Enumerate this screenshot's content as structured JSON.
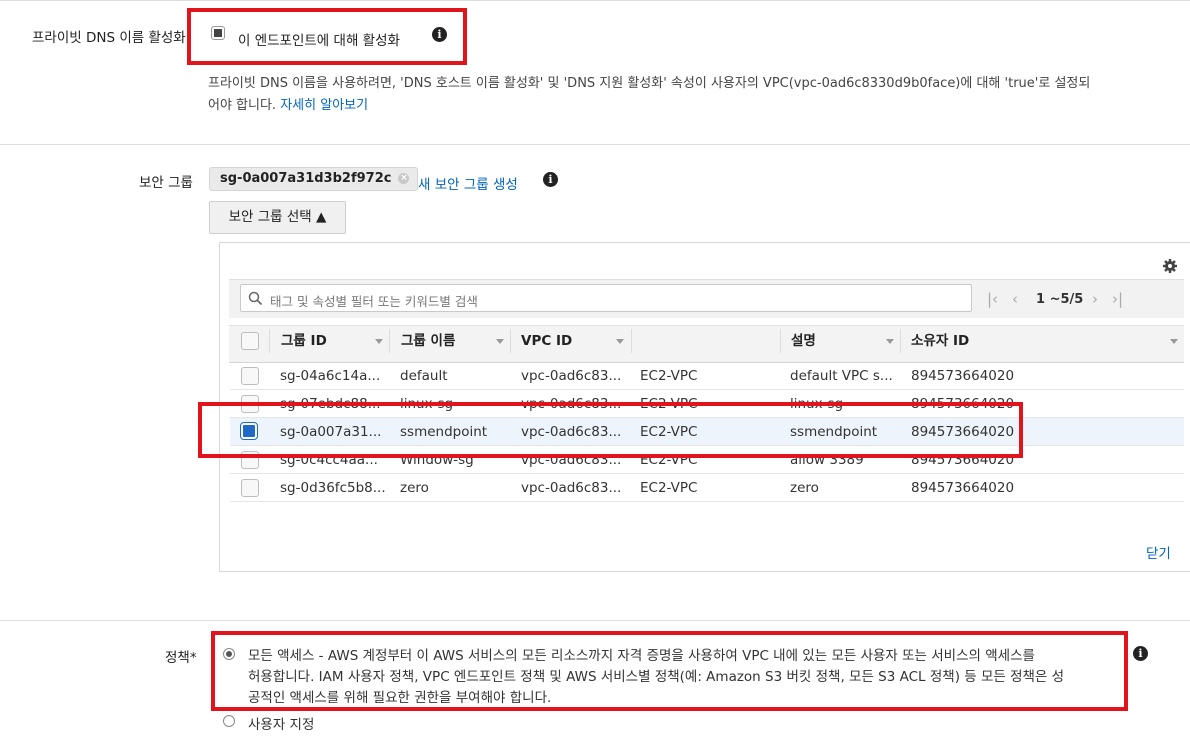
{
  "private_dns": {
    "label": "프라이빗 DNS 이름 활성화",
    "checkbox_label": "이 엔드포인트에 대해 활성화",
    "checked": true,
    "help_text": "프라이빗 DNS 이름을 사용하려면, 'DNS 호스트 이름 활성화' 및 'DNS 지원 활성화' 속성이 사용자의 VPC(vpc-0ad6c8330d9b0face)에 대해 'true'로 설정되",
    "help_text_2": "어야 합니다.",
    "learn_more": "자세히 알아보기"
  },
  "security_group": {
    "label": "보안 그룹",
    "selected_token": "sg-0a007a31d3b2f972c",
    "create_link": "새 보안 그룹 생성",
    "select_button": "보안 그룹 선택 ▲",
    "search_placeholder": "태그 및 속성별 필터 또는 키워드별 검색",
    "pagination": "1 ~5/5",
    "close_link": "닫기",
    "columns": [
      "그룹 ID",
      "그룹 이름",
      "VPC ID",
      "",
      "설명",
      "소유자 ID"
    ],
    "rows": [
      {
        "group_id": "sg-04a6c14a...",
        "group_name": "default",
        "vpc_id": "vpc-0ad6c83...",
        "platform": "EC2-VPC",
        "description": "default VPC s...",
        "owner": "894573664020",
        "checked": false
      },
      {
        "group_id": "sg-07ebdc88...",
        "group_name": "linux-sg",
        "vpc_id": "vpc-0ad6c83...",
        "platform": "EC2-VPC",
        "description": "linux-sg",
        "owner": "894573664020",
        "checked": false
      },
      {
        "group_id": "sg-0a007a31...",
        "group_name": "ssmendpoint",
        "vpc_id": "vpc-0ad6c83...",
        "platform": "EC2-VPC",
        "description": "ssmendpoint",
        "owner": "894573664020",
        "checked": true
      },
      {
        "group_id": "sg-0c4cc4aa...",
        "group_name": "Window-sg",
        "vpc_id": "vpc-0ad6c83...",
        "platform": "EC2-VPC",
        "description": "allow 3389",
        "owner": "894573664020",
        "checked": false
      },
      {
        "group_id": "sg-0d36fc5b8...",
        "group_name": "zero",
        "vpc_id": "vpc-0ad6c83...",
        "platform": "EC2-VPC",
        "description": "zero",
        "owner": "894573664020",
        "checked": false
      }
    ]
  },
  "policy": {
    "label": "정책*",
    "option_full_line1": "모든 액세스 - AWS 계정부터 이 AWS 서비스의 모든 리소스까지 자격 증명을 사용하여 VPC 내에 있는 모든 사용자 또는 서비스의 액세스를",
    "option_full_line2": "허용합니다. IAM 사용자 정책, VPC 엔드포인트 정책 및 AWS 서비스별 정책(예: Amazon S3 버킷 정책, 모든 S3 ACL 정책) 등 모든 정책은 성",
    "option_full_line3": "공적인 액세스를 위해 필요한 권한을 부여해야 합니다.",
    "option_custom": "사용자 지정",
    "selected": "full"
  },
  "colors": {
    "highlight": "#e1141b",
    "link": "#0066c0",
    "accent": "#1f6ac7"
  },
  "icons": [
    "info-icon",
    "gear-icon",
    "search-icon",
    "clear-token-icon",
    "pager-first-icon",
    "pager-prev-icon",
    "pager-next-icon",
    "pager-last-icon"
  ]
}
